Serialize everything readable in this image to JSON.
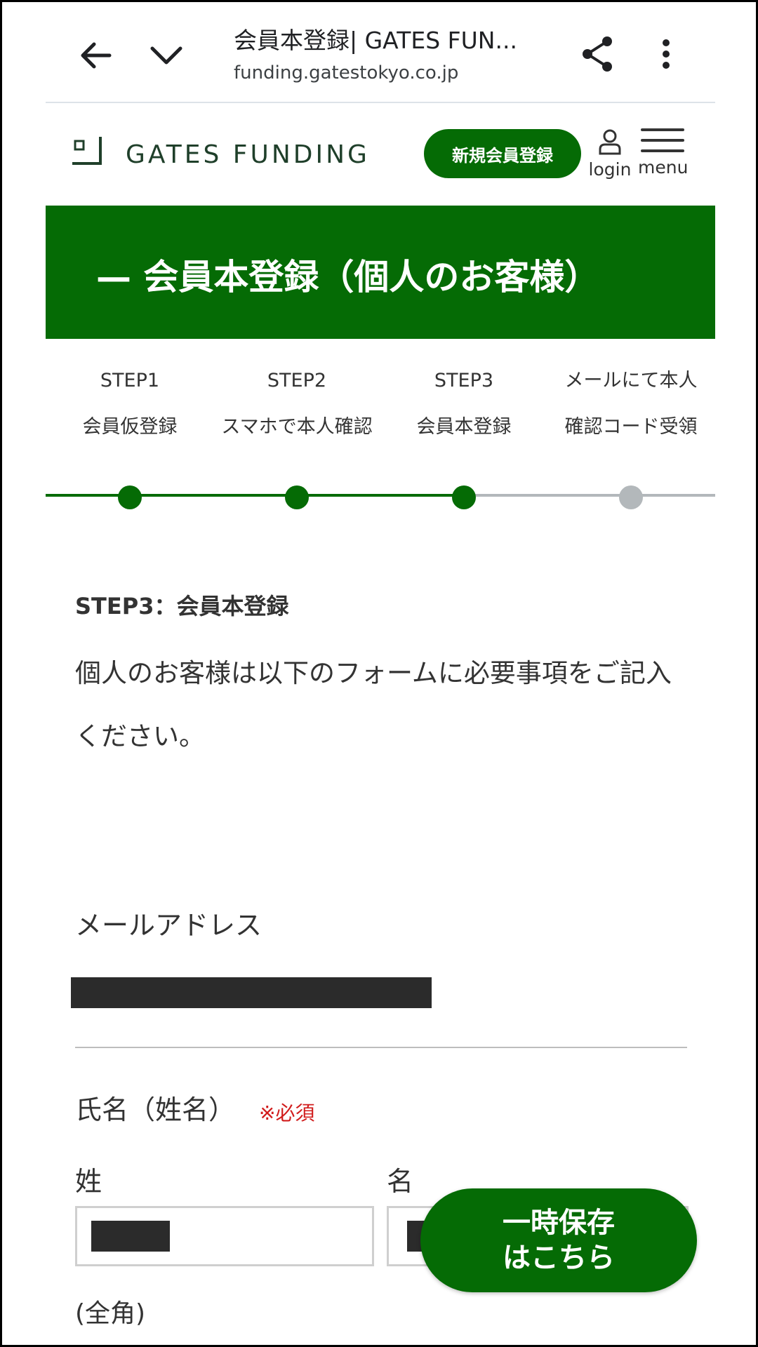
{
  "browser": {
    "title": "会員本登録| GATES FUN...",
    "url": "funding.gatestokyo.co.jp",
    "icons": [
      "back-arrow-icon",
      "chevron-down-icon",
      "share-icon",
      "more-vert-icon"
    ]
  },
  "header": {
    "logo_text": "GATES FUNDING",
    "signup_label": "新規会員登録",
    "login_label": "login",
    "menu_label": "menu"
  },
  "banner": {
    "title": "— 会員本登録（個人のお客様）"
  },
  "steps": [
    {
      "line1": "STEP1",
      "line2": "会員仮登録",
      "status": "done"
    },
    {
      "line1": "STEP2",
      "line2": "スマホで本人確認",
      "status": "done"
    },
    {
      "line1": "STEP3",
      "line2": "会員本登録",
      "status": "current"
    },
    {
      "line1": "メールにて本人",
      "line2": "確認コード受領",
      "status": "pending"
    }
  ],
  "content": {
    "step_heading": "STEP3：会員本登録",
    "intro": "個人のお客様は以下のフォームに必要事項をご記入ください。"
  },
  "form": {
    "email_label": "メールアドレス",
    "name_label": "氏名（姓名）",
    "required_label": "※必須",
    "last_name_label": "姓",
    "first_name_label": "名",
    "hint": "(全角)"
  },
  "save_button": {
    "line1": "一時保存",
    "line2": "はこちら"
  },
  "colors": {
    "brand_green": "#056b05",
    "progress_pending": "#b3b8bb",
    "required_red": "#d11c1c"
  }
}
